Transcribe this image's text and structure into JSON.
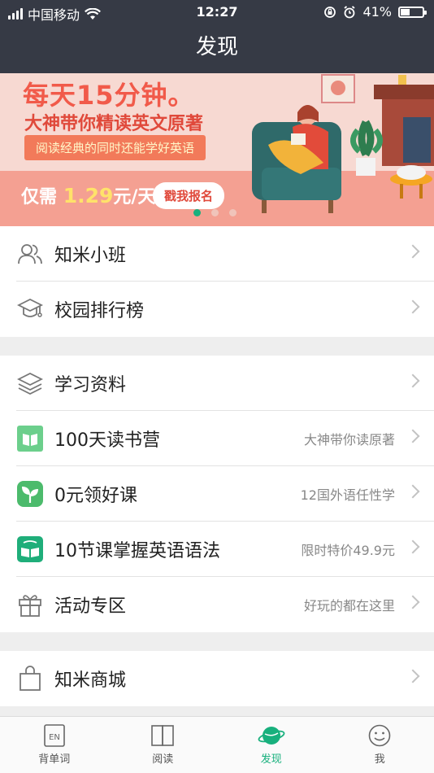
{
  "status": {
    "carrier": "中国移动",
    "time": "12:27",
    "battery": "41%",
    "battery_level": 0.41
  },
  "navbar": {
    "title": "发现"
  },
  "banner": {
    "headline": "每天15分钟。",
    "subtitle": "大神带你精读英文原著",
    "pill": "阅读经典的同时还能学好英语",
    "price_prefix": "仅需",
    "price": "1.29",
    "price_suffix": "元/天",
    "cta": "戳我报名",
    "active_dot": 0
  },
  "section1": [
    {
      "label": "知米小班",
      "hint": "",
      "icon": "people-icon"
    },
    {
      "label": "校园排行榜",
      "hint": "",
      "icon": "graduation-cap-icon"
    }
  ],
  "section2": [
    {
      "label": "学习资料",
      "hint": "",
      "icon": "layers-icon"
    },
    {
      "label": "100天读书营",
      "hint": "大神带你读原著",
      "icon": "book-icon"
    },
    {
      "label": "0元领好课",
      "hint": "12国外语任性学",
      "icon": "sprout-icon"
    },
    {
      "label": "10节课掌握英语语法",
      "hint": "限时特价49.9元",
      "icon": "grammar-book-icon"
    },
    {
      "label": "活动专区",
      "hint": "好玩的都在这里",
      "icon": "gift-icon"
    }
  ],
  "section3": [
    {
      "label": "知米商城",
      "hint": "",
      "icon": "shopping-bag-icon"
    }
  ],
  "tabs": [
    {
      "label": "背单词",
      "icon": "en-card-icon"
    },
    {
      "label": "阅读",
      "icon": "open-book-icon"
    },
    {
      "label": "发现",
      "icon": "planet-icon",
      "active": true
    },
    {
      "label": "我",
      "icon": "smiley-icon"
    }
  ],
  "colors": {
    "accent": "#18b07d",
    "navbar": "#363a45",
    "banner_text": "#f15a4a"
  }
}
